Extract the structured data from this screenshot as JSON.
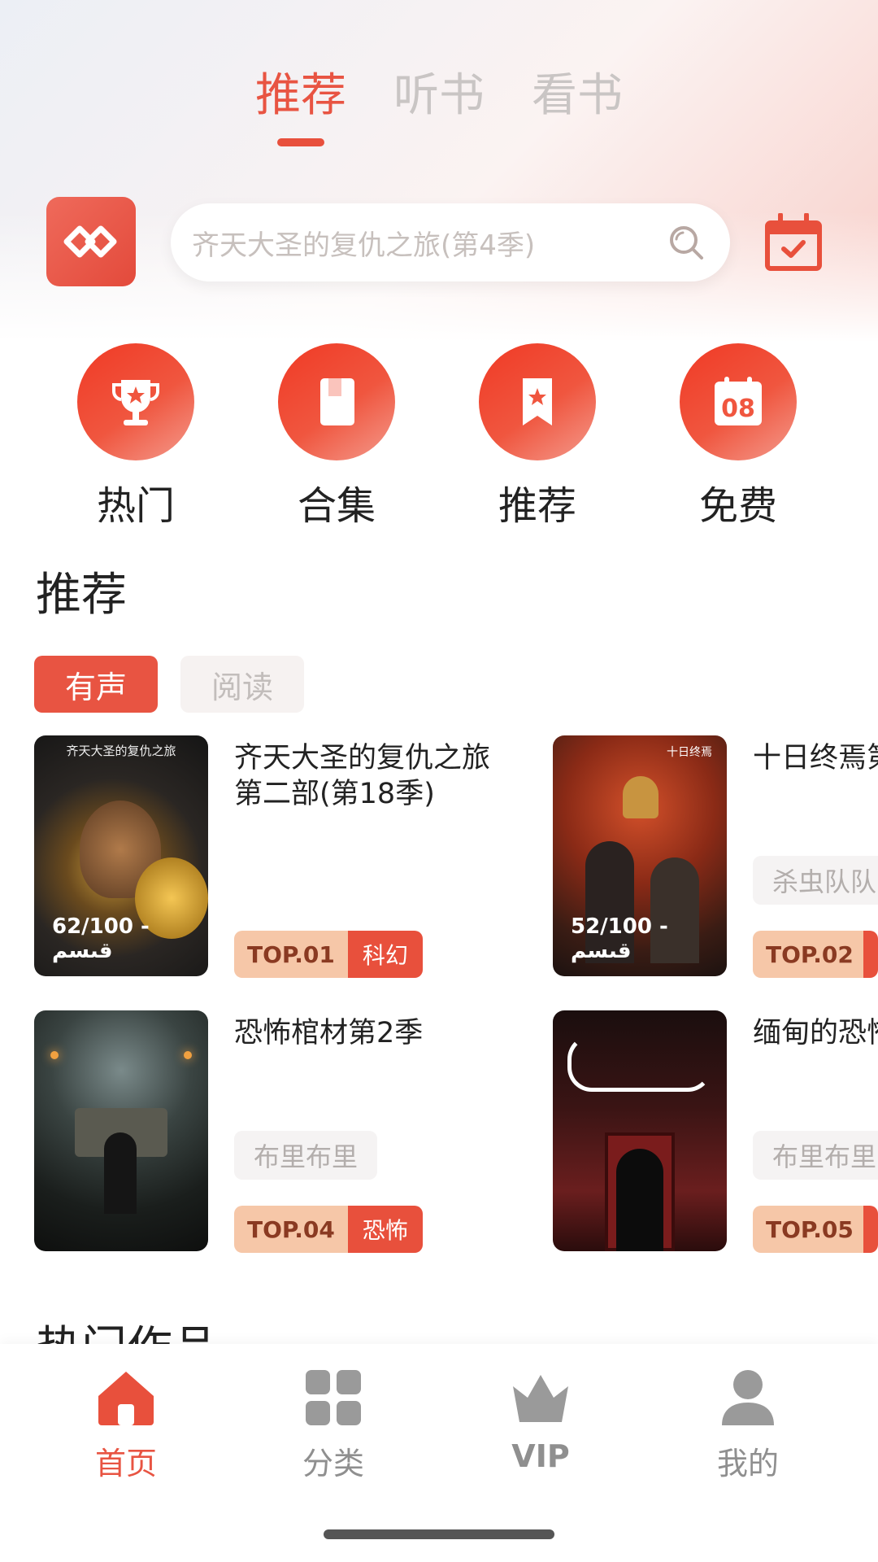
{
  "top_tabs": [
    {
      "label": "推荐",
      "active": true
    },
    {
      "label": "听书",
      "active": false
    },
    {
      "label": "看书",
      "active": false
    }
  ],
  "search": {
    "placeholder": "齐天大圣的复仇之旅(第4季)"
  },
  "quick_entries": [
    {
      "label": "热门",
      "icon": "trophy-icon"
    },
    {
      "label": "合集",
      "icon": "book-icon"
    },
    {
      "label": "推荐",
      "icon": "bookmark-star-icon"
    },
    {
      "label": "免费",
      "icon": "calendar-08-icon",
      "badge": "08"
    }
  ],
  "recommend": {
    "title": "推荐",
    "sub_tabs": [
      {
        "label": "有声",
        "active": true
      },
      {
        "label": "阅读",
        "active": false
      }
    ],
    "books": [
      {
        "title": "齐天大圣的复仇之旅第二部(第18季)",
        "cover_caption": "齐天大圣的复仇之旅",
        "progress": "62/100 - قىسم",
        "rank": "TOP.01",
        "category": "科幻",
        "author": ""
      },
      {
        "title": "十日终焉第",
        "cover_caption": "十日终焉",
        "progress": "52/100 - قىسم",
        "rank": "TOP.02",
        "category": "",
        "author": "杀虫队队"
      },
      {
        "title": "恐怖棺材第2季",
        "cover_caption": "",
        "progress": "",
        "rank": "TOP.04",
        "category": "恐怖",
        "author": "布里布里"
      },
      {
        "title": "缅甸的恐怖",
        "cover_caption": "",
        "progress": "",
        "rank": "TOP.05",
        "category": "",
        "author": "布里布里"
      }
    ]
  },
  "hot_section": {
    "title": "热门作品"
  },
  "bottom_nav": [
    {
      "label": "首页",
      "icon": "home-icon",
      "active": true
    },
    {
      "label": "分类",
      "icon": "grid-icon",
      "active": false
    },
    {
      "label": "VIP",
      "icon": "crown-icon",
      "active": false
    },
    {
      "label": "我的",
      "icon": "user-icon",
      "active": false
    }
  ],
  "colors": {
    "accent": "#e85442",
    "tag_top": "#f6c7a8"
  }
}
